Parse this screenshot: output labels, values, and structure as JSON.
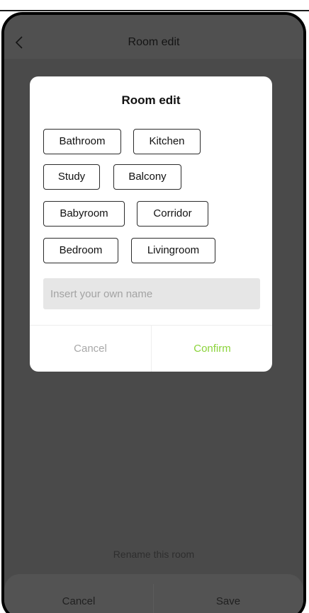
{
  "header": {
    "title": "Room edit",
    "back_icon": "chevron-left-icon"
  },
  "dialog": {
    "title": "Room edit",
    "room_options": [
      "Bathroom",
      "Kitchen",
      "Study",
      "Balcony",
      "Babyroom",
      "Corridor",
      "Bedroom",
      "Livingroom"
    ],
    "name_input": {
      "placeholder": "Insert your own name",
      "value": ""
    },
    "cancel_label": "Cancel",
    "confirm_label": "Confirm"
  },
  "footer": {
    "rename_label": "Rename this room",
    "cancel_label": "Cancel",
    "save_label": "Save"
  },
  "colors": {
    "accent": "#8bd33a",
    "overlay": "#4a4a4a",
    "input_background": "#e6e6e6"
  }
}
